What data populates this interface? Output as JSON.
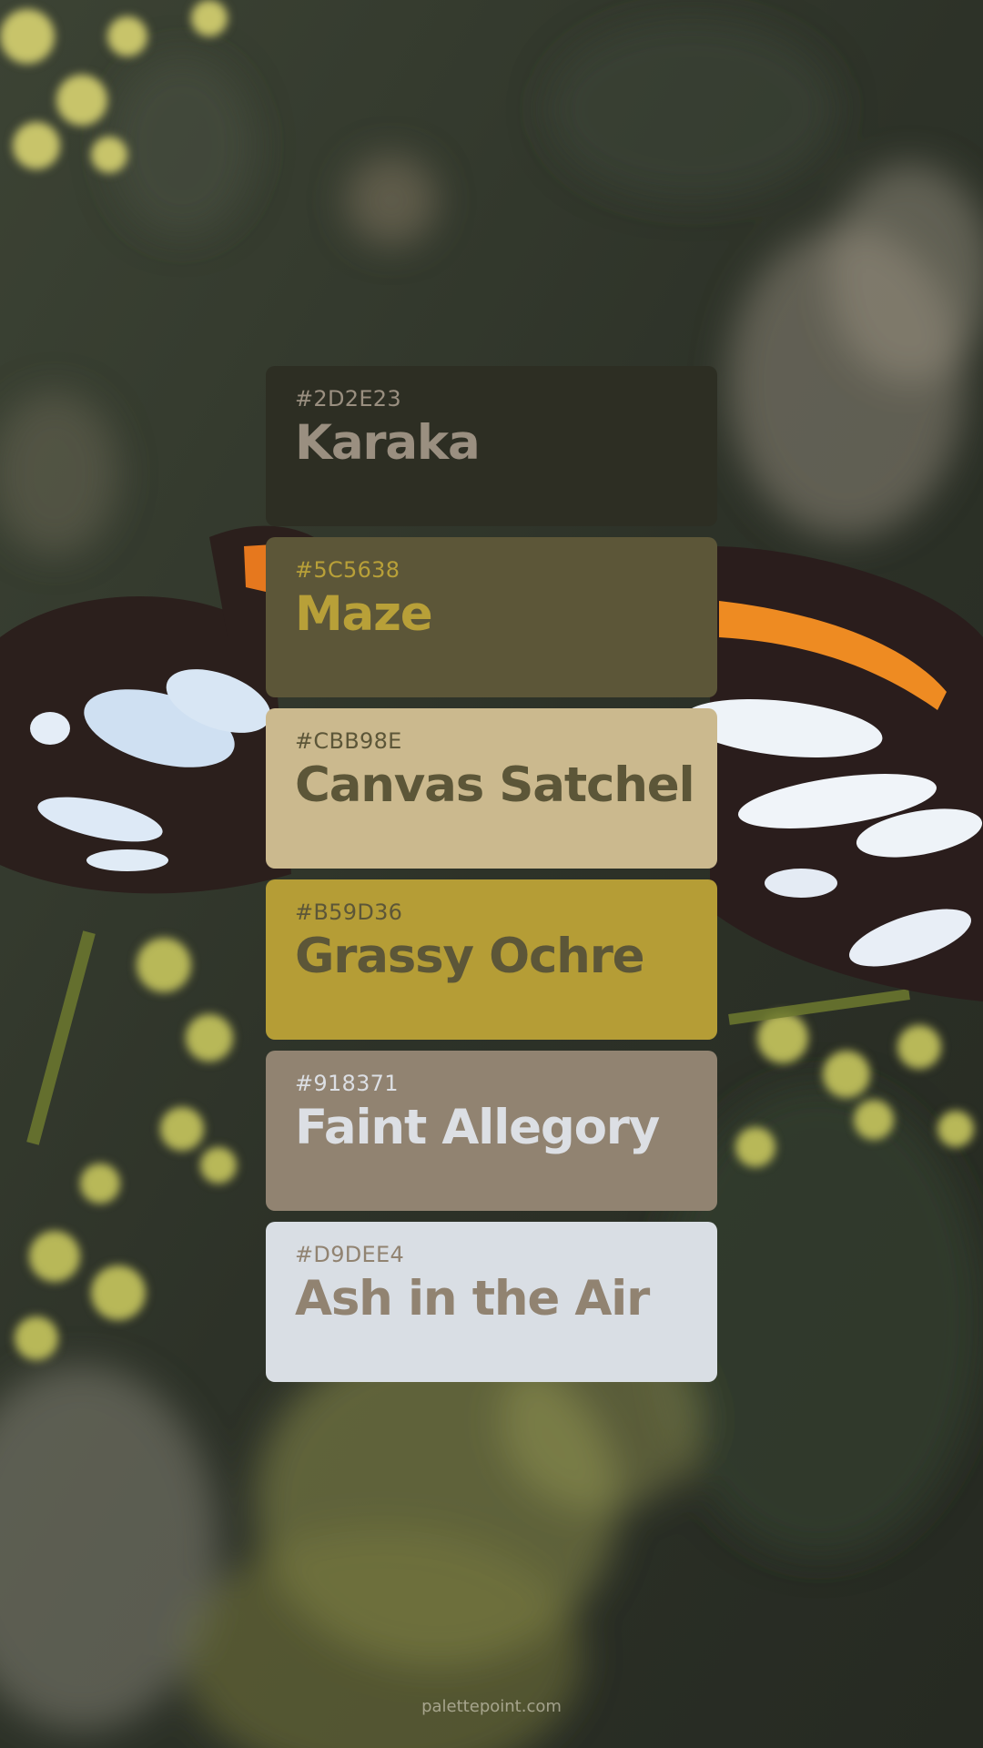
{
  "palette": [
    {
      "hex": "#2D2E23",
      "name": "Karaka",
      "text_color": "#9a8f80"
    },
    {
      "hex": "#5C5638",
      "name": "Maze",
      "text_color": "#b8a038"
    },
    {
      "hex": "#CBB98E",
      "name": "Canvas Satchel",
      "text_color": "#5c5638"
    },
    {
      "hex": "#B59D36",
      "name": "Grassy Ochre",
      "text_color": "#5c5638"
    },
    {
      "hex": "#918371",
      "name": "Faint Allegory",
      "text_color": "#dcdfe4"
    },
    {
      "hex": "#D9DEE4",
      "name": "Ash in the Air",
      "text_color": "#918371"
    }
  ],
  "footer": {
    "credit": "palettepoint.com"
  }
}
